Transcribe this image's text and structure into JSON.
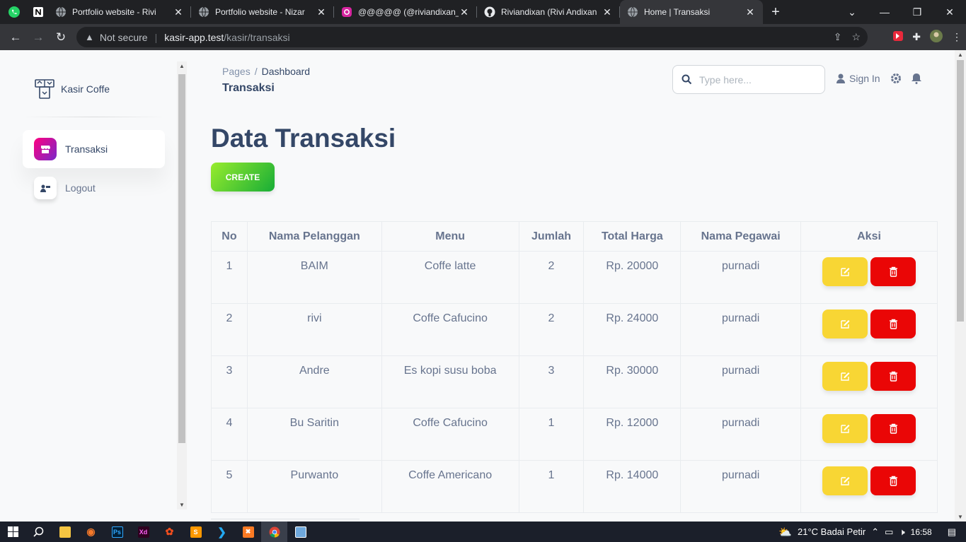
{
  "browser": {
    "tabs": [
      {
        "title": "Portfolio website - Rivi",
        "icon": "globe-icon"
      },
      {
        "title": "Portfolio website - Nizar",
        "icon": "globe-icon"
      },
      {
        "title": "@@@@@ (@riviandixan_)",
        "icon": "instagram-icon"
      },
      {
        "title": "Riviandixan (Rivi Andixan",
        "icon": "github-icon"
      },
      {
        "title": "Home | Transaksi",
        "icon": "globe-icon",
        "active": true
      }
    ],
    "not_secure": "Not secure",
    "url_host": "kasir-app.test",
    "url_path": "/kasir/transaksi"
  },
  "sidebar": {
    "brand": "Kasir Coffe",
    "items": [
      {
        "label": "Transaksi",
        "icon": "shop-icon",
        "active": true
      },
      {
        "label": "Logout",
        "icon": "logout-icon",
        "active": false
      }
    ]
  },
  "header": {
    "breadcrumb_root": "Pages",
    "breadcrumb_current": "Dashboard",
    "page_title": "Transaksi",
    "search_placeholder": "Type here...",
    "signin_label": "Sign In"
  },
  "main": {
    "heading": "Data Transaksi",
    "create_label": "CREATE",
    "columns": [
      "No",
      "Nama Pelanggan",
      "Menu",
      "Jumlah",
      "Total Harga",
      "Nama Pegawai",
      "Aksi"
    ],
    "rows": [
      {
        "no": "1",
        "pelanggan": "BAIM",
        "menu": "Coffe latte",
        "jumlah": "2",
        "total": "Rp. 20000",
        "pegawai": "purnadi"
      },
      {
        "no": "2",
        "pelanggan": "rivi",
        "menu": "Coffe Cafucino",
        "jumlah": "2",
        "total": "Rp. 24000",
        "pegawai": "purnadi"
      },
      {
        "no": "3",
        "pelanggan": "Andre",
        "menu": "Es kopi susu boba",
        "jumlah": "3",
        "total": "Rp. 30000",
        "pegawai": "purnadi"
      },
      {
        "no": "4",
        "pelanggan": "Bu Saritin",
        "menu": "Coffe Cafucino",
        "jumlah": "1",
        "total": "Rp. 12000",
        "pegawai": "purnadi"
      },
      {
        "no": "5",
        "pelanggan": "Purwanto",
        "menu": "Coffe Americano",
        "jumlah": "1",
        "total": "Rp. 14000",
        "pegawai": "purnadi"
      }
    ]
  },
  "taskbar": {
    "weather": "21°C  Badai Petir",
    "time": "16:58"
  },
  "colors": {
    "accent": "#cb0c9f",
    "create": "#82d616",
    "edit": "#f8d634",
    "delete": "#ea0606"
  }
}
